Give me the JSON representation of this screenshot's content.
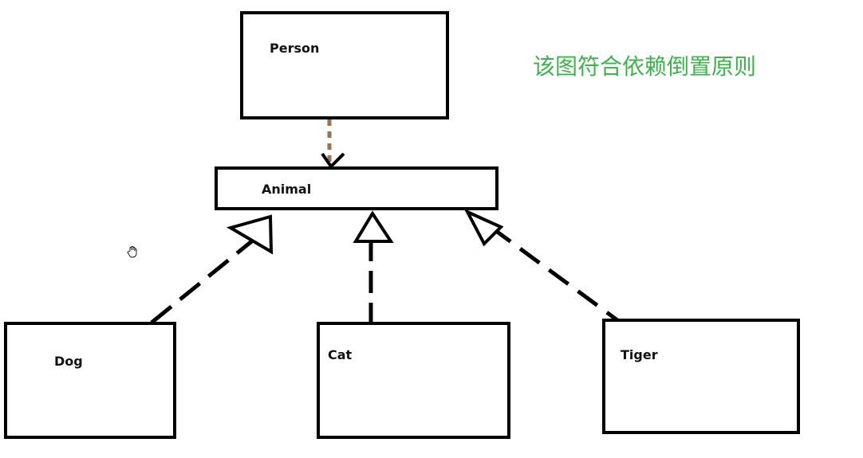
{
  "diagram": {
    "caption": "该图符合依赖倒置原则",
    "caption_color": "#3bb54a",
    "box_stroke": "#000000",
    "dependency_color": "#a0714a",
    "boxes": {
      "person": "Person",
      "animal": "Animal",
      "dog": "Dog",
      "cat": "Cat",
      "tiger": "Tiger"
    },
    "relations": [
      {
        "from": "Person",
        "to": "Animal",
        "kind": "dependency"
      },
      {
        "from": "Dog",
        "to": "Animal",
        "kind": "realization"
      },
      {
        "from": "Cat",
        "to": "Animal",
        "kind": "realization"
      },
      {
        "from": "Tiger",
        "to": "Animal",
        "kind": "realization"
      }
    ],
    "cursor_icon": "hand-cursor-icon"
  }
}
